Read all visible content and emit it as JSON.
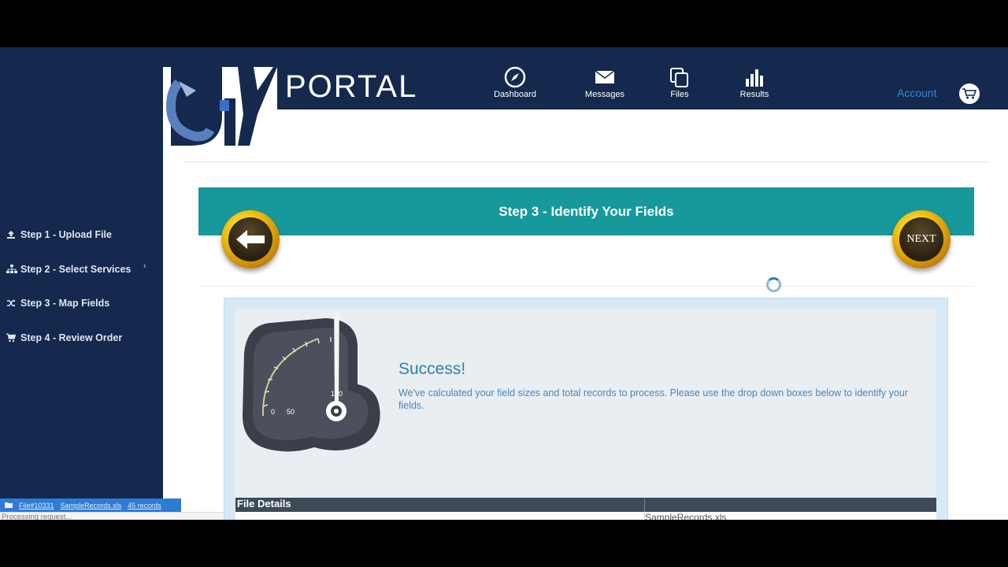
{
  "brand": {
    "portal_text": "PORTAL"
  },
  "nav": [
    {
      "label": "Dashboard",
      "icon": "compass-icon"
    },
    {
      "label": "Messages",
      "icon": "envelope-icon"
    },
    {
      "label": "Files",
      "icon": "files-icon"
    },
    {
      "label": "Results",
      "icon": "bar-chart-icon"
    }
  ],
  "account": {
    "label": "Account",
    "cart_icon": "cart-icon"
  },
  "sidebar": {
    "items": [
      {
        "label": "Step 1 - Upload File",
        "icon": "upload-icon"
      },
      {
        "label": "Step 2 - Select Services",
        "icon": "sitemap-icon"
      },
      {
        "label": "Step 3 - Map Fields",
        "icon": "shuffle-icon"
      },
      {
        "label": "Step 4 - Review Order",
        "icon": "cart-icon"
      }
    ],
    "file_chip": {
      "file": "File#10331",
      "name": "SampleRecords.xls",
      "records": "45 records"
    },
    "status": "Processing request..."
  },
  "step": {
    "title": "Step 3 - Identify Your Fields",
    "next_label": "NEXT"
  },
  "gauge": {
    "ticks": [
      "0",
      "50",
      "100"
    ],
    "value": 100
  },
  "success": {
    "title": "Success!",
    "message": "We've calculated your field sizes and total records to process. Please use the drop down boxes below to identify your fields."
  },
  "details": {
    "header": "File Details",
    "row_value": "SampleRecords.xls"
  },
  "colors": {
    "sidebar": "#14294d",
    "banner": "#17989b",
    "accent": "#2f7fb3",
    "gold": "#f4c20d"
  }
}
